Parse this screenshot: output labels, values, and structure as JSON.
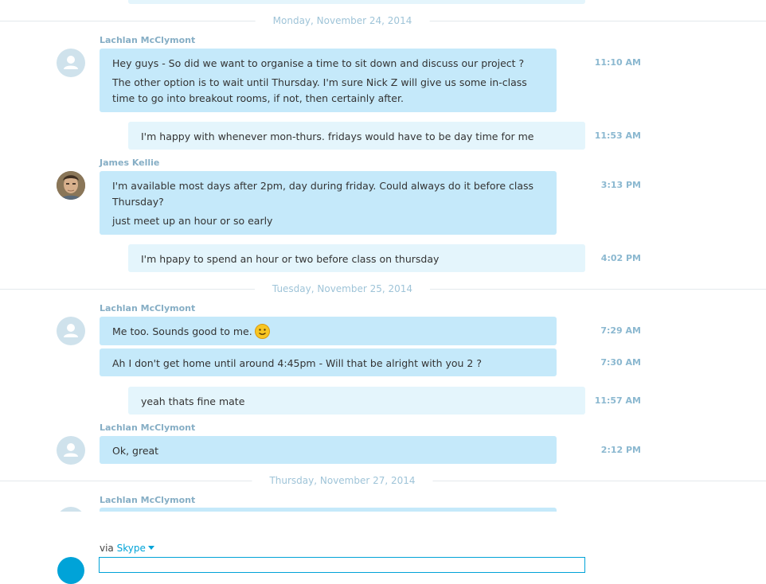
{
  "dates": [
    "Monday, November 24, 2014",
    "Tuesday, November 25, 2014",
    "Thursday, November 27, 2014"
  ],
  "groups": [
    {
      "sender": "Lachlan McClymont",
      "messages": [
        {
          "lines": [
            "Hey guys - So did we want to organise a time to sit down and discuss our project ?",
            "The other option is to wait until Thursday. I'm sure Nick Z will give us some in-class time to go into breakout rooms, if not, then certainly after."
          ],
          "time": "11:10 AM"
        }
      ]
    },
    {
      "sender": "",
      "outgoing": true,
      "messages": [
        {
          "text": "I'm happy with whenever mon-thurs. fridays  would have to be day time  for me",
          "time": "11:53 AM"
        }
      ]
    },
    {
      "sender": "James Kellie",
      "messages": [
        {
          "lines": [
            "I'm available most days after 2pm, day during friday. Could always do it before class Thursday?",
            "just meet up an hour or so early"
          ],
          "time": "3:13 PM"
        }
      ]
    },
    {
      "sender": "",
      "outgoing": true,
      "messages": [
        {
          "text": "I'm hpapy to spend an hour or two before class on thursday",
          "time": "4:02 PM"
        }
      ]
    },
    {
      "sender": "Lachlan McClymont",
      "messages": [
        {
          "text": "Me too. Sounds good to me.",
          "emoji": "smiley-emoji-icon",
          "time": "7:29 AM"
        },
        {
          "text": "Ah I don't get home until around 4:45pm - Will that be alright with you 2 ?",
          "time": "7:30 AM"
        }
      ]
    },
    {
      "sender": "",
      "outgoing": true,
      "messages": [
        {
          "text": "yeah thats fine mate",
          "time": "11:57 AM"
        }
      ]
    },
    {
      "sender": "Lachlan McClymont",
      "messages": [
        {
          "text": "Ok, great",
          "time": "2:12 PM"
        }
      ]
    },
    {
      "sender": "Lachlan McClymont",
      "messages": []
    }
  ],
  "composer": {
    "via_label": "via",
    "service": "Skype"
  },
  "colors": {
    "incoming_bubble": "#c5e9fa",
    "outgoing_bubble": "#e4f5fc",
    "accent": "#00a3d8",
    "timestamp": "#8bb8d0",
    "sender_name": "#86aec5"
  }
}
